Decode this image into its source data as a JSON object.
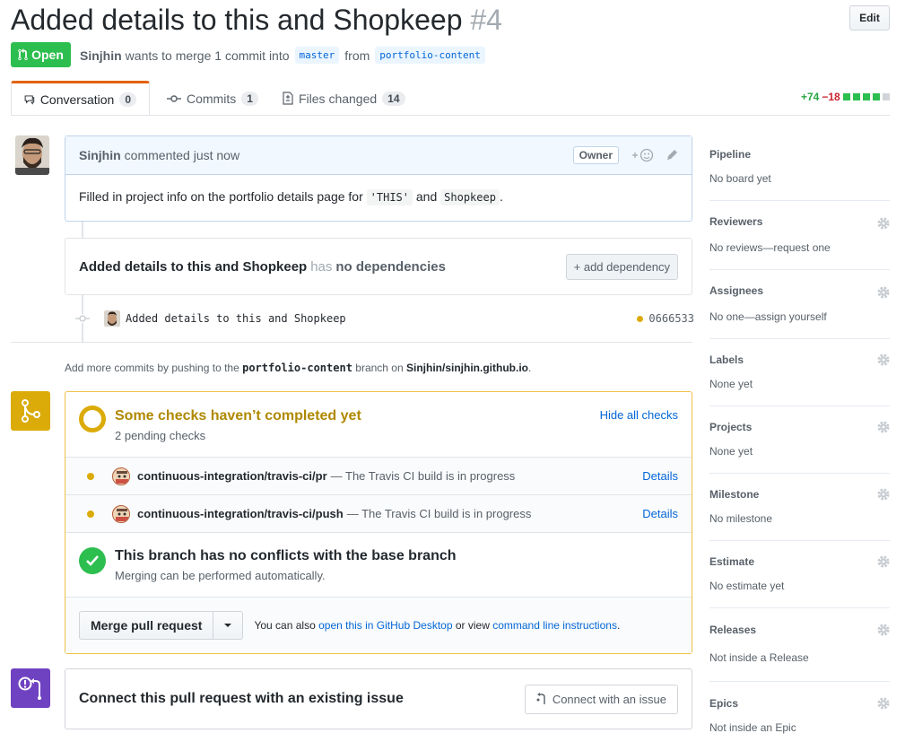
{
  "header": {
    "title": "Added details to this and Shopkeep",
    "number": "#4",
    "edit_label": "Edit",
    "state": "Open",
    "author": "Sinjhin",
    "merge_text": "wants to merge 1 commit into",
    "base_branch": "master",
    "from_text": "from",
    "head_branch": "portfolio-content"
  },
  "tabs": [
    {
      "label": "Conversation",
      "count": "0"
    },
    {
      "label": "Commits",
      "count": "1"
    },
    {
      "label": "Files changed",
      "count": "14"
    }
  ],
  "diffstat": {
    "additions": "+74",
    "deletions": "−18"
  },
  "comment": {
    "author": "Sinjhin",
    "action": "commented just now",
    "badge": "Owner",
    "body_prefix": "Filled in project info on the portfolio details page for",
    "code1": "'THIS'",
    "and": "and",
    "code2": "Shopkeep",
    "suffix": "."
  },
  "dependency": {
    "title": "Added details to this and Shopkeep",
    "has": "has",
    "status": "no dependencies",
    "button": "+ add dependency"
  },
  "commit": {
    "message": "Added details to this and Shopkeep",
    "sha": "0666533"
  },
  "push_hint": {
    "prefix": "Add more commits by pushing to the",
    "branch": "portfolio-content",
    "middle": "branch on",
    "repo": "Sinjhin/sinjhin.github.io",
    "suffix": "."
  },
  "checks": {
    "title": "Some checks haven’t completed yet",
    "subtitle": "2 pending checks",
    "hide_link": "Hide all checks",
    "rows": [
      {
        "name": "continuous-integration/travis-ci/pr",
        "desc": "— The Travis CI build is in progress",
        "link": "Details"
      },
      {
        "name": "continuous-integration/travis-ci/push",
        "desc": "— The Travis CI build is in progress",
        "link": "Details"
      }
    ]
  },
  "conflicts": {
    "title": "This branch has no conflicts with the base branch",
    "subtitle": "Merging can be performed automatically."
  },
  "merge": {
    "button": "Merge pull request",
    "also": "You can also",
    "desktop_link": "open this in GitHub Desktop",
    "or_view": "or view",
    "cli_link": "command line instructions",
    "end": "."
  },
  "issue": {
    "title": "Connect this pull request with an existing issue",
    "button": "Connect with an issue"
  },
  "sidebar": [
    {
      "heading": "Pipeline",
      "value": "No board yet"
    },
    {
      "heading": "Reviewers",
      "value": "No reviews—request one"
    },
    {
      "heading": "Assignees",
      "value": "No one—assign yourself"
    },
    {
      "heading": "Labels",
      "value": "None yet"
    },
    {
      "heading": "Projects",
      "value": "None yet"
    },
    {
      "heading": "Milestone",
      "value": "No milestone"
    },
    {
      "heading": "Estimate",
      "value": "No estimate yet"
    },
    {
      "heading": "Releases",
      "value": "Not inside a Release"
    },
    {
      "heading": "Epics",
      "value": "Not inside an Epic"
    }
  ],
  "colors": {
    "open": "#2cbe4e",
    "pending": "#dbab09",
    "link": "#0366d6",
    "issue": "#6f42c1"
  }
}
